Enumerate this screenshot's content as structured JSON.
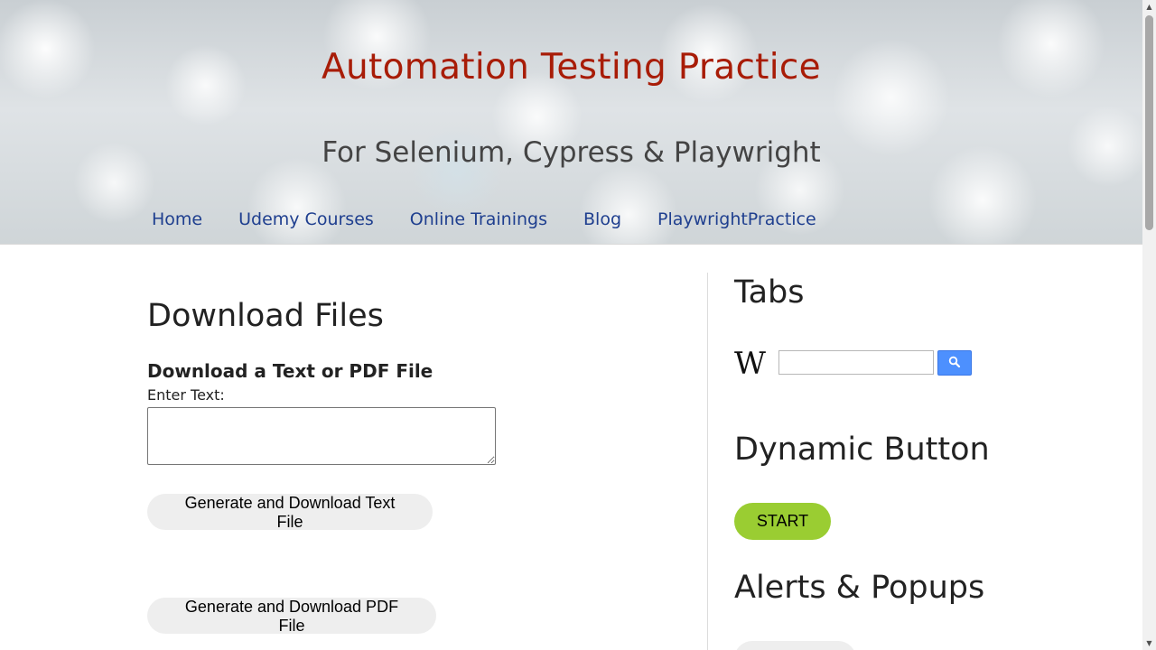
{
  "header": {
    "title": "Automation Testing Practice",
    "tagline": "For Selenium, Cypress & Playwright",
    "title_color": "#a81c07",
    "nav": [
      {
        "label": "Home"
      },
      {
        "label": "Udemy Courses"
      },
      {
        "label": "Online Trainings"
      },
      {
        "label": "Blog"
      },
      {
        "label": "PlaywrightPractice"
      }
    ]
  },
  "main": {
    "section_title": "Download Files",
    "subtitle": "Download a Text or PDF File",
    "field_label": "Enter Text:",
    "textarea_value": "",
    "text_button": "Generate and Download Text File",
    "pdf_button": "Generate and Download PDF File"
  },
  "sidebar": {
    "tabs_title": "Tabs",
    "wiki_logo": "W",
    "wiki_search_value": "",
    "wiki_search_icon": "search-icon",
    "dynamic_title": "Dynamic Button",
    "start_button": "START",
    "start_button_color": "#9acd32",
    "alerts_title": "Alerts & Popups"
  },
  "scrollbar": {
    "up_icon": "triangle-up-icon",
    "down_icon": "triangle-down-icon"
  }
}
